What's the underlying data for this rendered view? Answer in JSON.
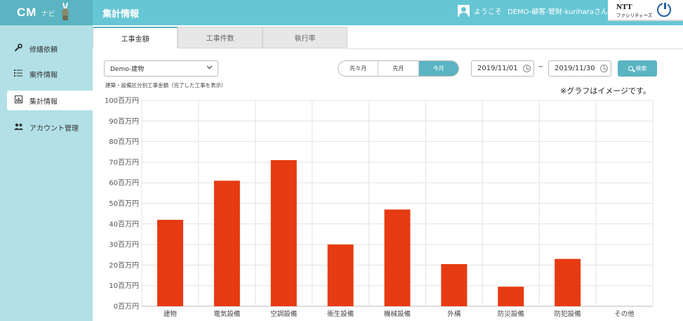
{
  "header": {
    "logo_text": "CM",
    "logo_sub": "ナビ",
    "page_title": "集計情報",
    "user_greeting": "ようこそ",
    "user_name": "DEMO-顧客-管財-kuriharaさん ▾",
    "brand_name": "NTT",
    "brand_sub": "ファシリティーズ"
  },
  "sidebar": {
    "items": [
      {
        "label": "修繕依頼",
        "icon": "wrench-icon"
      },
      {
        "label": "案件情報",
        "icon": "list-icon"
      },
      {
        "label": "集計情報",
        "icon": "bar-chart-icon",
        "active": true
      },
      {
        "label": "アカウント管理",
        "icon": "users-icon"
      }
    ]
  },
  "tabs": [
    {
      "label": "工事金額",
      "active": true
    },
    {
      "label": "工事件数"
    },
    {
      "label": "執行率"
    }
  ],
  "filters": {
    "building_select": "Demo-建物",
    "period_buttons": [
      {
        "label": "先々月"
      },
      {
        "label": "先月"
      },
      {
        "label": "今月",
        "active": true
      }
    ],
    "date_from": "2019/11/01",
    "date_to": "2019/11/30",
    "date_separator": "~",
    "search_label": "検索"
  },
  "chart_caption": "建築・設備区分別工事金額（完了した工事を表示）",
  "note": "※グラフはイメージです。",
  "colors": {
    "accent": "#66c6d4",
    "bar": "#e63b12",
    "sidebar": "#b2e0e6"
  },
  "chart_data": {
    "type": "bar",
    "categories": [
      "建物",
      "電気設備",
      "空調設備",
      "衛生設備",
      "機械設備",
      "外構",
      "防災設備",
      "防犯設備",
      "その他"
    ],
    "values": [
      42,
      61,
      71,
      30,
      47,
      20.5,
      9.5,
      23,
      0
    ],
    "yticks": [
      "0百万円",
      "10百万円",
      "20百万円",
      "30百万円",
      "40百万円",
      "50百万円",
      "60百万円",
      "70百万円",
      "80百万円",
      "90百万円",
      "100百万円"
    ],
    "ylim": [
      0,
      100
    ],
    "grid": true
  }
}
